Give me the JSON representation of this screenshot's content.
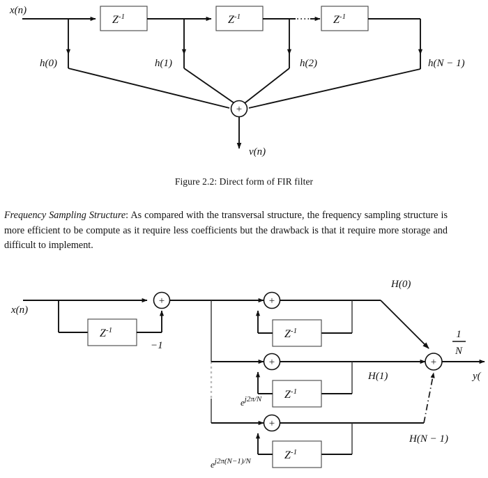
{
  "document": {
    "caption": "Figure 2.2: Direct form of FIR filter",
    "paragraph_lead": "Frequency Sampling Structure",
    "paragraph_rest": ": As compared with the transversal structure, the frequency sampling structure is more efficient to be compute as it require less coefficients but the drawback is that it require more storage and difficult to implement."
  },
  "figure_direct_form": {
    "name": "Direct form of FIR filter",
    "input_label": "x(n)",
    "output_label": "v(n)",
    "delay_label": "Z",
    "delay_exponent": "-1",
    "adder_symbol": "+",
    "ellipsis": "⋯",
    "taps": [
      {
        "label": "h(0)"
      },
      {
        "label": "h(1)"
      },
      {
        "label": "h(2)"
      },
      {
        "label": "h(N − 1)"
      }
    ],
    "delay_blocks": [
      {
        "base": "Z",
        "exp": "-1"
      },
      {
        "base": "Z",
        "exp": "-1"
      },
      {
        "base": "Z",
        "exp": "-1"
      }
    ]
  },
  "figure_freq_sampling": {
    "name": "Frequency sampling structure",
    "input_label": "x(n)",
    "output_label": "y(",
    "gain_numerator": "1",
    "gain_denominator": "N",
    "comb_coefficient": "−1",
    "adder_symbol": "+",
    "delay_label": "Z",
    "delay_exponent": "-1",
    "resonators": [
      {
        "feedback_coefficient": "",
        "tap_label": "H(0)",
        "delay_base": "Z",
        "delay_exp": "-1"
      },
      {
        "feedback_coefficient": "e",
        "feedback_exponent": "j2π/N",
        "tap_label": "H(1)",
        "delay_base": "Z",
        "delay_exp": "-1"
      },
      {
        "feedback_coefficient": "e",
        "feedback_exponent": "j2π(N−1)/N",
        "tap_label": "H(N − 1)",
        "delay_base": "Z",
        "delay_exp": "-1"
      }
    ]
  },
  "colors": {
    "wire": "#111111",
    "box_stroke": "#444444",
    "background": "#ffffff",
    "text": "#111111",
    "faded_line": "#bbbbbb"
  }
}
